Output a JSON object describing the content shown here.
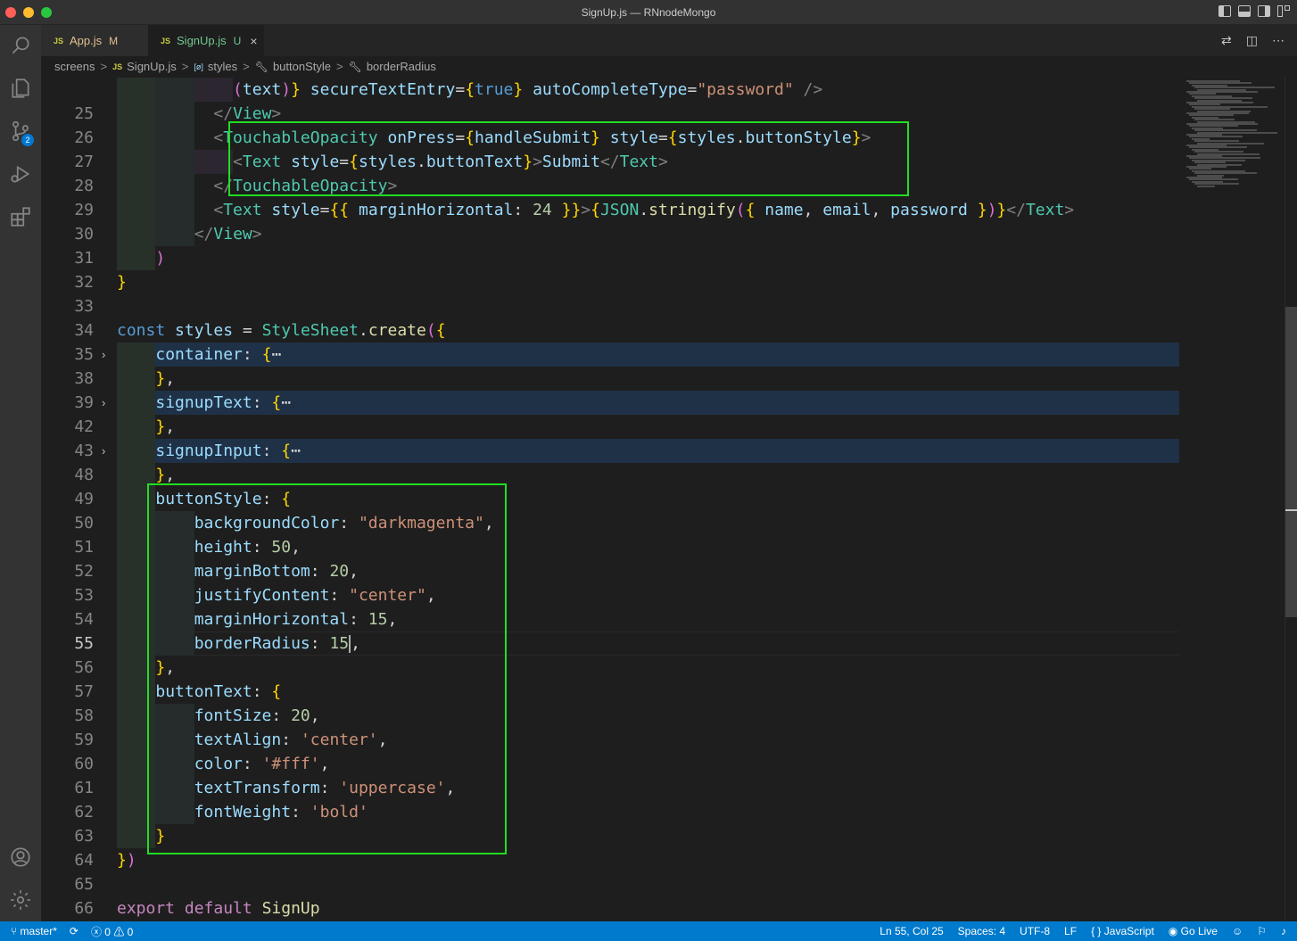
{
  "window": {
    "title": "SignUp.js — RNnodeMongo"
  },
  "activity": {
    "items": [
      {
        "name": "explorer",
        "icon": "files-icon"
      },
      {
        "name": "search",
        "icon": "search-icon"
      },
      {
        "name": "source-control",
        "icon": "source-control-icon",
        "badge": "2"
      },
      {
        "name": "run-debug",
        "icon": "run-debug-icon"
      },
      {
        "name": "extensions",
        "icon": "extensions-icon"
      }
    ],
    "bottom": [
      {
        "name": "accounts",
        "icon": "account-icon"
      },
      {
        "name": "manage",
        "icon": "gear-icon"
      }
    ]
  },
  "tabs": [
    {
      "label": "App.js",
      "status": "M",
      "icon": "JS",
      "active": false
    },
    {
      "label": "SignUp.js",
      "status": "U",
      "icon": "JS",
      "active": true,
      "close": "×"
    }
  ],
  "breadcrumb": {
    "items": [
      "screens",
      "SignUp.js",
      "styles",
      "buttonStyle",
      "borderRadius"
    ],
    "separator": ">",
    "js_badge": "JS",
    "var_badge": "[ø]"
  },
  "editor": {
    "lines": [
      {
        "n": "",
        "text": "            (text)} secureTextEntry={true} autoCompleteType=\"password\" />"
      },
      {
        "n": "25",
        "text": "          </View>"
      },
      {
        "n": "26",
        "text": "          <TouchableOpacity onPress={handleSubmit} style={styles.buttonStyle}>"
      },
      {
        "n": "27",
        "text": "            <Text style={styles.buttonText}>Submit</Text>"
      },
      {
        "n": "28",
        "text": "          </TouchableOpacity>"
      },
      {
        "n": "29",
        "text": "          <Text style={{ marginHorizontal: 24 }}>{JSON.stringify({ name, email, password })}</Text>"
      },
      {
        "n": "30",
        "text": "        </View>"
      },
      {
        "n": "31",
        "text": "    )"
      },
      {
        "n": "32",
        "text": "}"
      },
      {
        "n": "33",
        "text": ""
      },
      {
        "n": "34",
        "text": "const styles = StyleSheet.create({"
      },
      {
        "n": "35",
        "text": "    container: {⋯"
      },
      {
        "n": "38",
        "text": "    },"
      },
      {
        "n": "39",
        "text": "    signupText: {⋯"
      },
      {
        "n": "42",
        "text": "    },"
      },
      {
        "n": "43",
        "text": "    signupInput: {⋯"
      },
      {
        "n": "48",
        "text": "    },"
      },
      {
        "n": "49",
        "text": "    buttonStyle: {"
      },
      {
        "n": "50",
        "text": "        backgroundColor: \"darkmagenta\","
      },
      {
        "n": "51",
        "text": "        height: 50,"
      },
      {
        "n": "52",
        "text": "        marginBottom: 20,"
      },
      {
        "n": "53",
        "text": "        justifyContent: \"center\","
      },
      {
        "n": "54",
        "text": "        marginHorizontal: 15,"
      },
      {
        "n": "55",
        "text": "        borderRadius: 15,"
      },
      {
        "n": "56",
        "text": "    },"
      },
      {
        "n": "57",
        "text": "    buttonText: {"
      },
      {
        "n": "58",
        "text": "        fontSize: 20,"
      },
      {
        "n": "59",
        "text": "        textAlign: 'center',"
      },
      {
        "n": "60",
        "text": "        color: '#fff',"
      },
      {
        "n": "61",
        "text": "        textTransform: 'uppercase',"
      },
      {
        "n": "62",
        "text": "        fontWeight: 'bold'"
      },
      {
        "n": "63",
        "text": "    }"
      },
      {
        "n": "64",
        "text": "})"
      },
      {
        "n": "65",
        "text": ""
      },
      {
        "n": "66",
        "text": "export default SignUp"
      }
    ],
    "active_line": "55"
  },
  "statusbar": {
    "branch": "master*",
    "sync_icon": "sync-icon",
    "errors": "0",
    "warnings": "0",
    "position": "Ln 55, Col 25",
    "spaces": "Spaces: 4",
    "encoding": "UTF-8",
    "eol": "LF",
    "language_braces": "{ }",
    "language": "JavaScript",
    "golive": "Go Live"
  },
  "colors": {
    "accent": "#007acc",
    "highlight_box": "#22dd22",
    "editor_bg": "#1e1e1e"
  }
}
